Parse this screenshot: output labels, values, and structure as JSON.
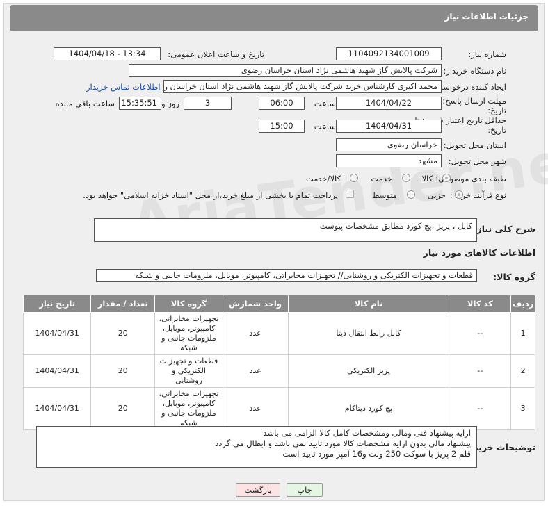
{
  "header": {
    "title": "جزئیات اطلاعات نیاز"
  },
  "labels": {
    "need_number": "شماره نیاز:",
    "announce_datetime": "تاریخ و ساعت اعلان عمومی:",
    "buyer_org": "نام دستگاه خریدار:",
    "requester": "ایجاد کننده درخواست:",
    "reply_deadline": "مهلت ارسال پاسخ: تا تاریخ:",
    "price_validity": "حداقل تاریخ اعتبار قیمت: تا تاریخ:",
    "time": "ساعت",
    "day_and": "روز و",
    "time_remaining": "ساعت باقی مانده",
    "delivery_province": "استان محل تحویل:",
    "delivery_city": "شهر محل تحویل:",
    "category": "طبقه بندی موضوعی:",
    "purchase_type": "نوع فرآیند خرید :",
    "need_description": "شرح کلی نیاز:",
    "goods_info": "اطلاعات کالاهای مورد نیاز",
    "goods_group": "گروه کالا:",
    "buyer_notes": "توضیحات خریدار:"
  },
  "values": {
    "need_number": "1104092134001009",
    "announce_datetime": "1404/04/18 - 13:34",
    "buyer_org": "شرکت پالایش گاز شهید هاشمی نژاد   استان خراسان رضوی",
    "requester": "محمد اکبری کارشناس خرید شرکت پالایش گاز شهید هاشمی نژاد   استان خراسان رضوی",
    "contact_link": "اطلاعات تماس خریدار",
    "reply_date": "1404/04/22",
    "reply_time": "06:00",
    "reply_days": "3",
    "reply_remaining": "15:35:51",
    "validity_date": "1404/04/31",
    "validity_time": "15:00",
    "delivery_province": "خراسان رضوی",
    "delivery_city": "مشهد",
    "need_description": "کابل ، پریز ،پچ کورد مطابق مشخصات پیوست",
    "goods_group": "قطعات و تجهیزات الکتریکی و روشنایی// تجهیزات مخابراتی، کامپیوتر، موبایل، ملزومات جانبی و شبکه"
  },
  "category_options": [
    "کالا",
    "خدمت",
    "کالا/خدمت"
  ],
  "purchase_options": [
    "جزیی",
    "متوسط"
  ],
  "payment_note": "پرداخت تمام یا بخشی از مبلغ خرید،از محل \"اسناد خزانه اسلامی\" خواهد بود.",
  "table": {
    "headers": [
      "ردیف",
      "کد کالا",
      "نام کالا",
      "واحد شمارش",
      "گروه کالا",
      "تعداد / مقدار",
      "تاریخ نیاز"
    ],
    "rows": [
      {
        "row": "1",
        "code": "--",
        "name": "کابل رابط انتقال دیتا",
        "unit": "عدد",
        "group": "تجهیزات مخابراتی، کامپیوتر، موبایل، ملزومات جانبی و شبکه",
        "qty": "20",
        "date": "1404/04/31"
      },
      {
        "row": "2",
        "code": "--",
        "name": "پریز الکتریکی",
        "unit": "عدد",
        "group": "قطعات و تجهیزات الکتریکی و روشنایی",
        "qty": "20",
        "date": "1404/04/31"
      },
      {
        "row": "3",
        "code": "--",
        "name": "پچ کورد دیتاکام",
        "unit": "عدد",
        "group": "تجهیزات مخابراتی، کامپیوتر، موبایل، ملزومات جانبی و شبکه",
        "qty": "20",
        "date": "1404/04/31"
      }
    ]
  },
  "buyer_notes": {
    "line1": "ارایه پیشنهاد فنی ومالی ومشخصات کامل کالا الزامی می باشد",
    "line2": "پیشنهاد مالی بدون ارایه مشخصات کالا مورد تایید نمی باشد و ابطال می گردد",
    "line3": "قلم 2 پریز با سوکت 250 ولت و16 آمپر مورد تایید است"
  },
  "buttons": {
    "print": "چاپ",
    "back": "بازگشت"
  },
  "watermark": "AriaTender.net",
  "colors": {
    "header_bg": "#8a8a8a",
    "link": "#1a4fa0",
    "back_btn_bg": "#fde3e3",
    "print_btn_bg": "#e5f6e5"
  }
}
